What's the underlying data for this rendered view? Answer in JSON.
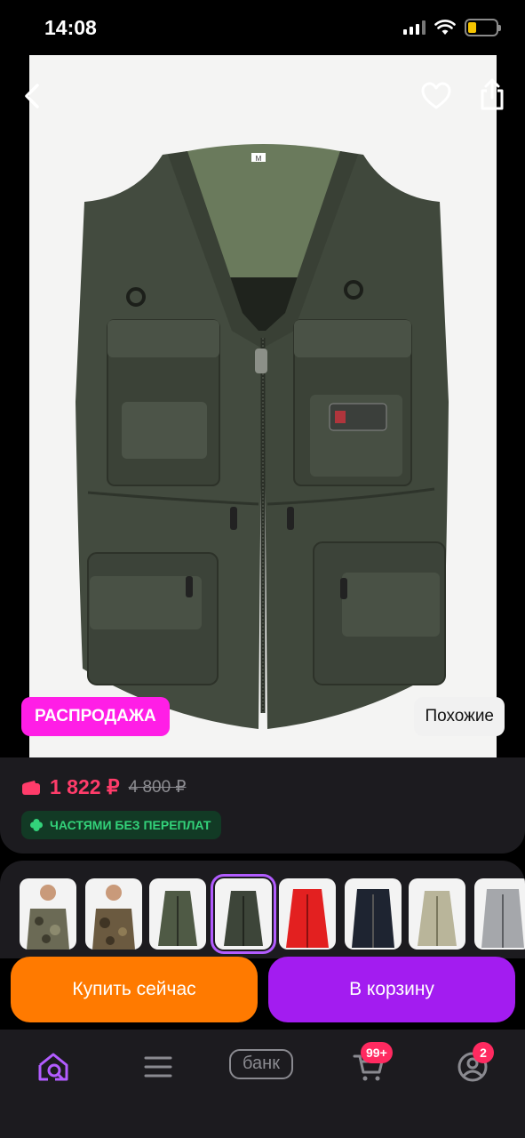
{
  "status_bar": {
    "time": "14:08"
  },
  "product": {
    "sale_badge": "РАСПРОДАЖА",
    "similar_label": "Похожие",
    "price_current": "1 822 ₽",
    "price_old": "4 800 ₽",
    "installment_label": "ЧАСТЯМИ БЕЗ ПЕРЕПЛАТ",
    "vest_label_text": "M"
  },
  "variants": [
    {
      "name": "camo-vest-model-1",
      "colors": [
        "#6b6a55",
        "#4e4c3c"
      ]
    },
    {
      "name": "camo-vest-model-2",
      "colors": [
        "#6b5a40",
        "#4c4030"
      ]
    },
    {
      "name": "olive-vest",
      "colors": [
        "#4f5a45"
      ]
    },
    {
      "name": "dark-green-vest",
      "colors": [
        "#3d4539"
      ],
      "selected": true
    },
    {
      "name": "red-vest",
      "colors": [
        "#e32020"
      ]
    },
    {
      "name": "navy-vest",
      "colors": [
        "#1e2431"
      ]
    },
    {
      "name": "khaki-vest",
      "colors": [
        "#b9b59a"
      ]
    },
    {
      "name": "grey-vest",
      "colors": [
        "#a5a7ab"
      ]
    }
  ],
  "actions": {
    "buy_now": "Купить сейчас",
    "add_to_cart": "В корзину"
  },
  "nav": {
    "bank_label": "банк",
    "cart_badge": "99+",
    "profile_badge": "2"
  },
  "colors": {
    "sale_pink": "#ff1ee6",
    "price_red": "#ff3c6a",
    "buy_orange": "#ff7a00",
    "cart_purple": "#a31cf0",
    "home_active": "#b25cff"
  }
}
